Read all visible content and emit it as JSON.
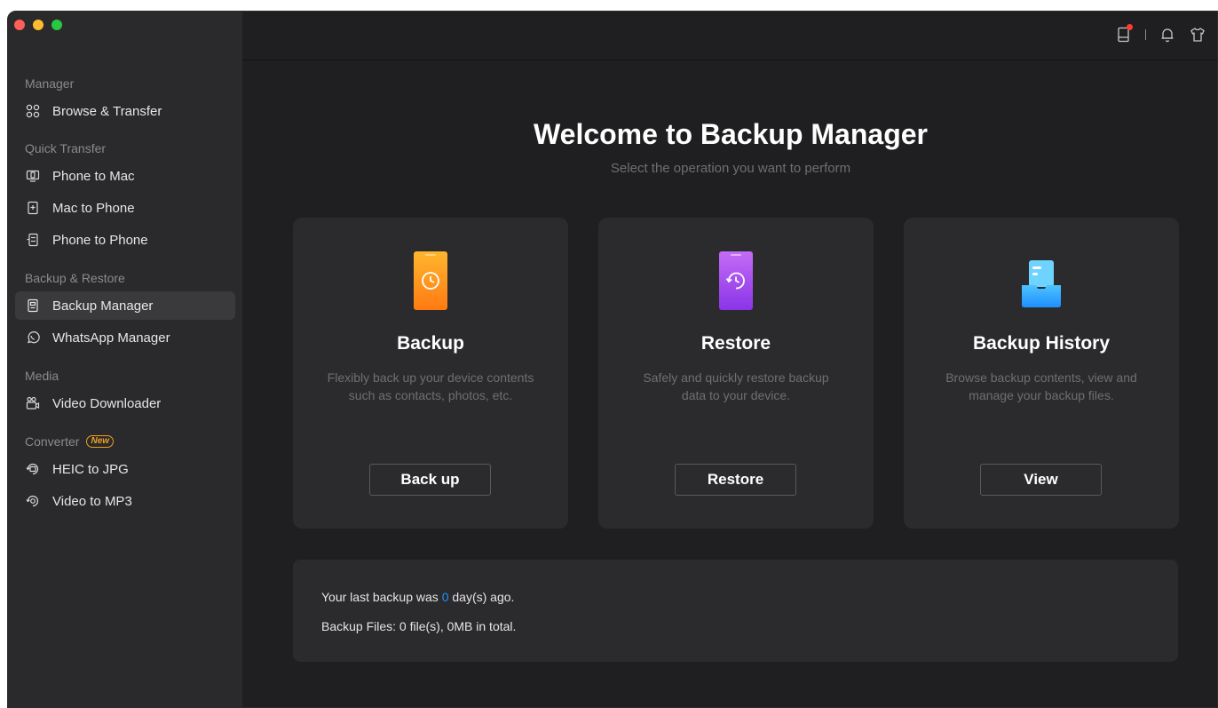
{
  "window": {
    "controls": [
      "close",
      "minimize",
      "zoom"
    ]
  },
  "sidebar": {
    "sections": [
      {
        "label": "Manager",
        "items": [
          {
            "label": "Browse & Transfer",
            "icon": "grid-icon"
          }
        ]
      },
      {
        "label": "Quick Transfer",
        "items": [
          {
            "label": "Phone to Mac",
            "icon": "phone-to-mac-icon"
          },
          {
            "label": "Mac to Phone",
            "icon": "mac-to-phone-icon"
          },
          {
            "label": "Phone to Phone",
            "icon": "phone-to-phone-icon"
          }
        ]
      },
      {
        "label": "Backup & Restore",
        "items": [
          {
            "label": "Backup Manager",
            "icon": "backup-manager-icon",
            "active": true
          },
          {
            "label": "WhatsApp Manager",
            "icon": "whatsapp-icon"
          }
        ]
      },
      {
        "label": "Media",
        "items": [
          {
            "label": "Video Downloader",
            "icon": "video-downloader-icon"
          }
        ]
      },
      {
        "label": "Converter",
        "badge": "New",
        "items": [
          {
            "label": "HEIC to JPG",
            "icon": "heic-icon"
          },
          {
            "label": "Video to MP3",
            "icon": "video-to-mp3-icon"
          }
        ]
      }
    ]
  },
  "topbar": {
    "icons": [
      "device-icon",
      "bell-icon",
      "shirt-icon"
    ]
  },
  "main": {
    "title": "Welcome to Backup Manager",
    "subtitle": "Select the operation you want to perform",
    "cards": [
      {
        "title": "Backup",
        "desc_line1": "Flexibly back up your device contents",
        "desc_line2": "such as contacts, photos, etc.",
        "button": "Back up",
        "icon": "backup-phone-icon"
      },
      {
        "title": "Restore",
        "desc_line1": "Safely and quickly restore backup",
        "desc_line2": "data to your device.",
        "button": "Restore",
        "icon": "restore-phone-icon"
      },
      {
        "title": "Backup History",
        "desc_line1": "Browse backup contents, view and",
        "desc_line2": "manage your backup files.",
        "button": "View",
        "icon": "backup-history-icon"
      }
    ],
    "info": {
      "last_backup_prefix": "Your last backup was ",
      "last_backup_days": "0",
      "last_backup_suffix": " day(s) ago.",
      "files_line": "Backup Files: 0 file(s), 0MB in total."
    }
  },
  "colors": {
    "accent_blue": "#1e90ff",
    "badge_orange": "#f0a020"
  }
}
